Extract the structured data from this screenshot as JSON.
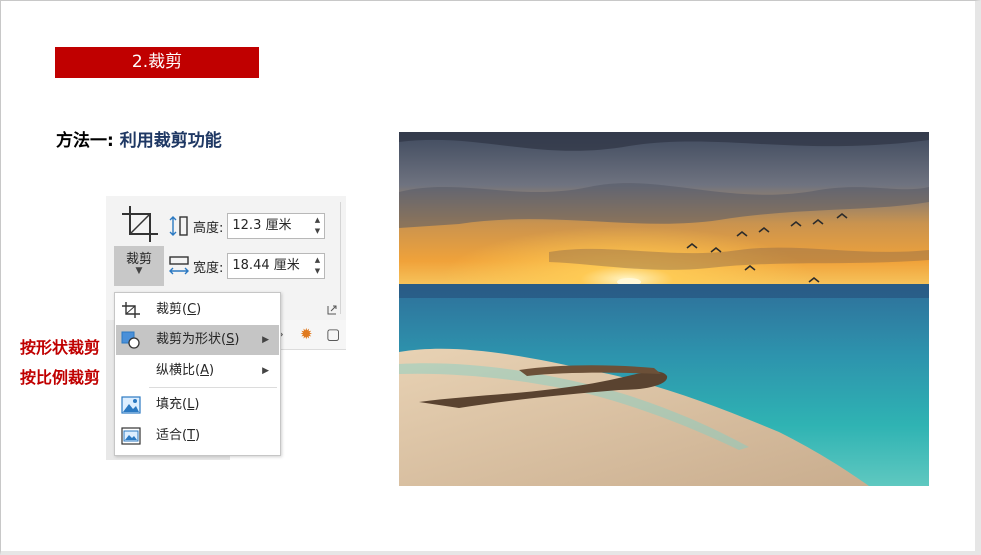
{
  "section": {
    "title": "2.裁剪"
  },
  "heading": {
    "prefix": "方法一: ",
    "accent": "利用裁剪功能"
  },
  "ribbon": {
    "crop_label": "裁剪",
    "height_label": "高度:",
    "height_value": "12.3 厘米",
    "width_label": "宽度:",
    "width_value": "18.44 厘米"
  },
  "menu": {
    "items": [
      {
        "label": "裁剪",
        "key": "C",
        "icon": "crop-icon"
      },
      {
        "label": "裁剪为形状",
        "key": "S",
        "icon": "crop-to-shape-icon",
        "submenu": true,
        "highlighted": true
      },
      {
        "label": "纵横比",
        "key": "A",
        "icon": "",
        "submenu": true
      },
      {
        "label": "填充",
        "key": "L",
        "icon": "fill-picture-icon"
      },
      {
        "label": "适合",
        "key": "T",
        "icon": "fit-picture-icon"
      }
    ]
  },
  "notes": {
    "by_shape": "按形状裁剪",
    "by_ratio": "按比例裁剪"
  },
  "colors": {
    "accent_red": "#c00000",
    "heading_blue": "#1f3864",
    "menu_highlight": "#c5c5c5"
  }
}
